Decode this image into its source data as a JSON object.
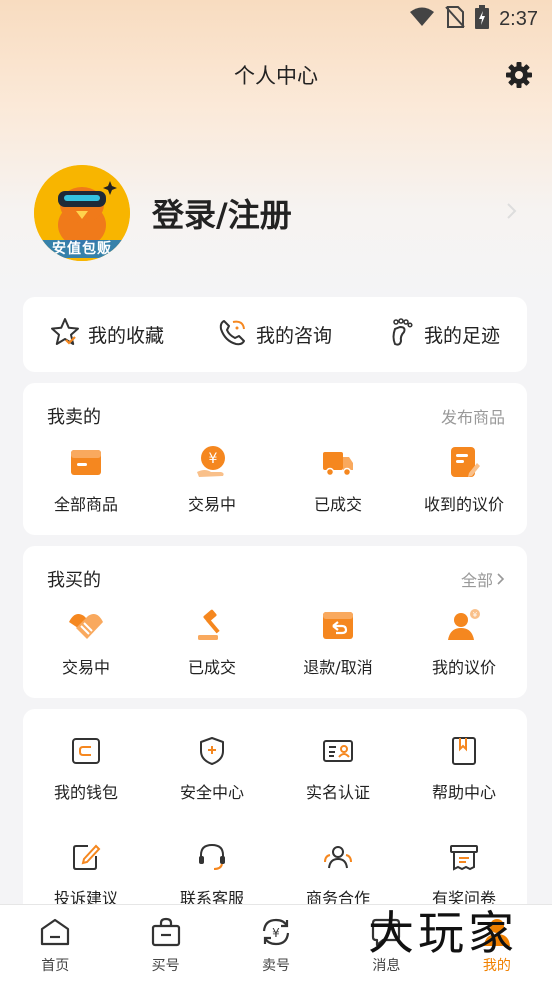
{
  "status": {
    "time": "2:37"
  },
  "header": {
    "title": "个人中心"
  },
  "profile": {
    "avatar_label": "安值包贩",
    "login_text": "登录/注册"
  },
  "quick": [
    {
      "label": "我的收藏",
      "icon": "star-icon"
    },
    {
      "label": "我的咨询",
      "icon": "phone-chat-icon"
    },
    {
      "label": "我的足迹",
      "icon": "footprint-icon"
    }
  ],
  "sell": {
    "title": "我卖的",
    "link": "发布商品",
    "items": [
      {
        "label": "全部商品",
        "icon": "folder-icon"
      },
      {
        "label": "交易中",
        "icon": "yen-hand-icon"
      },
      {
        "label": "已成交",
        "icon": "truck-icon"
      },
      {
        "label": "收到的议价",
        "icon": "note-edit-icon"
      }
    ]
  },
  "buy": {
    "title": "我买的",
    "link": "全部",
    "items": [
      {
        "label": "交易中",
        "icon": "handshake-icon"
      },
      {
        "label": "已成交",
        "icon": "gavel-icon"
      },
      {
        "label": "退款/取消",
        "icon": "refund-box-icon"
      },
      {
        "label": "我的议价",
        "icon": "user-price-icon"
      }
    ]
  },
  "more": {
    "row1": [
      {
        "label": "我的钱包",
        "icon": "wallet-icon"
      },
      {
        "label": "安全中心",
        "icon": "shield-icon"
      },
      {
        "label": "实名认证",
        "icon": "id-card-icon"
      },
      {
        "label": "帮助中心",
        "icon": "book-icon"
      }
    ],
    "row2": [
      {
        "label": "投诉建议",
        "icon": "complaint-edit-icon"
      },
      {
        "label": "联系客服",
        "icon": "headset-icon"
      },
      {
        "label": "商务合作",
        "icon": "team-icon"
      },
      {
        "label": "有奖问卷",
        "icon": "survey-icon"
      }
    ]
  },
  "nav": [
    {
      "label": "首页",
      "icon": "home-icon"
    },
    {
      "label": "买号",
      "icon": "shopping-bag-icon"
    },
    {
      "label": "卖号",
      "icon": "exchange-yen-icon"
    },
    {
      "label": "消息",
      "icon": "message-icon"
    },
    {
      "label": "我的",
      "icon": "profile-icon"
    }
  ],
  "watermark": "大玩家",
  "colors": {
    "accent": "#f08000",
    "orange": "#f5871f"
  }
}
